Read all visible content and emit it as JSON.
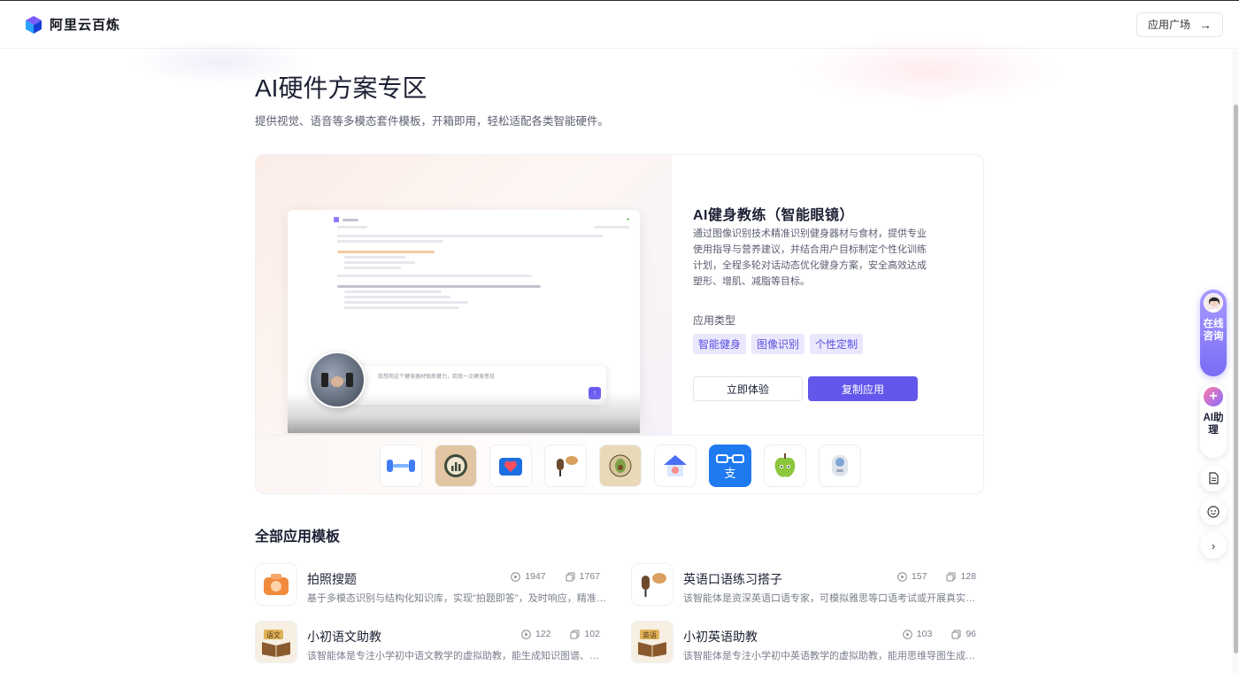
{
  "header": {
    "brand": "阿里云百炼",
    "app_plaza_label": "应用广场",
    "app_plaza_arrow": "→"
  },
  "page": {
    "title": "AI硬件方案专区",
    "subtitle": "提供视觉、语音等多模态套件模板，开箱即用，轻松适配各类智能硬件。"
  },
  "featured": {
    "title": "AI健身教练（智能眼镜）",
    "description": "通过图像识别技术精准识别健身器材与食材，提供专业使用指导与营养建议，并结合用户目标制定个性化训练计划，全程多轮对话动态优化健身方案，安全高效达成塑形、增肌、减脂等目标。",
    "type_label": "应用类型",
    "tags": [
      "智能健身",
      "图像识别",
      "个性定制"
    ],
    "try_label": "立即体验",
    "copy_label": "复制应用",
    "preview": {
      "input_placeholder": "我想用这个健身器材锻炼臂力，给我一点健身意见",
      "send_icon": "↑"
    }
  },
  "thumbnails": [
    {
      "icon": "dumbbell-icon"
    },
    {
      "icon": "chart-badge-icon"
    },
    {
      "icon": "heart-box-icon"
    },
    {
      "icon": "microphone-speech-icon"
    },
    {
      "icon": "avocado-icon"
    },
    {
      "icon": "house-icon"
    },
    {
      "icon": "glasses-pay-icon",
      "glyph": "支"
    },
    {
      "icon": "apple-icon"
    },
    {
      "icon": "robot-icon"
    }
  ],
  "section": {
    "title": "全部应用模板"
  },
  "templates": [
    {
      "title": "拍照搜题",
      "desc": "基于多模态识别与结构化知识库，实现\"拍题即答\"，及时响应，精准可靠。",
      "views": "1947",
      "copies": "1767",
      "icon": "camera-icon"
    },
    {
      "title": "英语口语练习搭子",
      "desc": "该智能体是资深英语口语专家，可模拟雅思等口语考试或开展真实场景对...",
      "views": "157",
      "copies": "128",
      "icon": "microphone-speech-icon"
    },
    {
      "title": "小初语文助教",
      "desc": "该智能体是专注小学初中语文教学的虚拟助教，能生成知识图谱、讲解课...",
      "views": "122",
      "copies": "102",
      "icon": "chinese-book-icon",
      "badge": "语文"
    },
    {
      "title": "小初英语助教",
      "desc": "该智能体是专注小学初中英语教学的虚拟助教，能用思维导图生成知识图...",
      "views": "103",
      "copies": "96",
      "icon": "english-book-icon",
      "badge": "英语"
    }
  ],
  "float_bar": {
    "consult_label": "在线咨询",
    "ai_label": "AI助理",
    "ai_glyph": "+",
    "expand_glyph": "›"
  },
  "colors": {
    "accent": "#6356ea",
    "tag_bg": "#ebe8fd",
    "tag_text": "#5a4fe0"
  }
}
